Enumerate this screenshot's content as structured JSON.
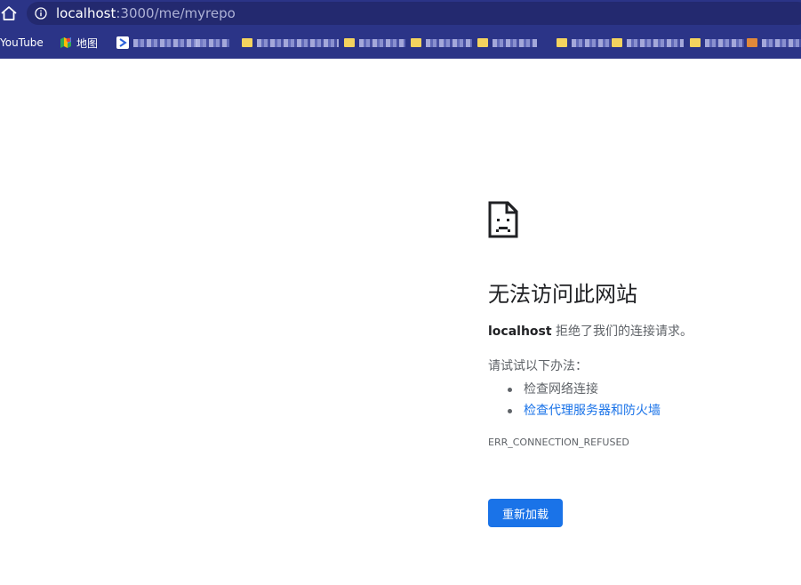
{
  "browser": {
    "url_host": "localhost",
    "url_path": ":3000/me/myrepo",
    "icons": {
      "home": "home-icon",
      "info": "info-icon"
    },
    "colors": {
      "toolbar": "#2b3487",
      "omnibox": "#23296f"
    }
  },
  "bookmarks": [
    {
      "label": "YouTube",
      "icon": "youtube-icon"
    },
    {
      "label": "地图",
      "icon": "maps-icon"
    }
  ],
  "error_page": {
    "icon": "sad-page-icon",
    "title": "无法访问此网站",
    "host": "localhost",
    "description_suffix": " 拒绝了我们的连接请求。",
    "try_label": "请试试以下办法：",
    "suggestions": [
      "检查网络连接",
      "检查代理服务器和防火墙"
    ],
    "error_code": "ERR_CONNECTION_REFUSED",
    "reload_label": "重新加载",
    "colors": {
      "link": "#1a73e8",
      "button": "#1a73e8",
      "body_text": "#5f6368",
      "heading": "#202124"
    }
  }
}
